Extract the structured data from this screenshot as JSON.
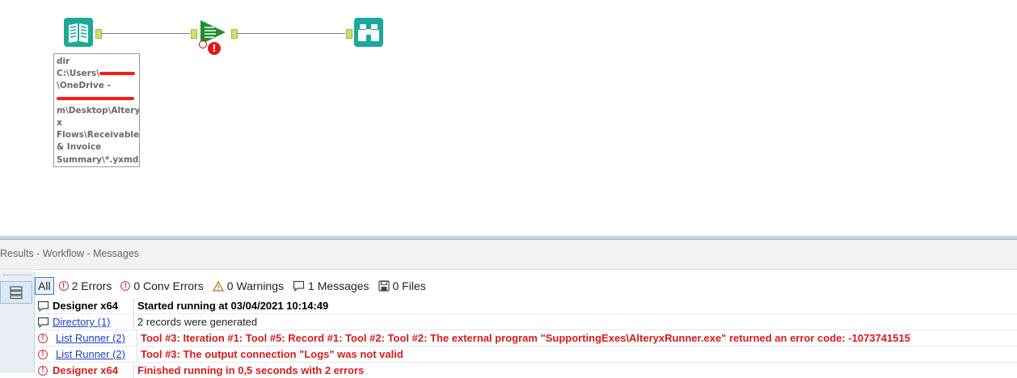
{
  "canvas": {
    "annotation": {
      "line1": "dir",
      "line2_prefix": "C:\\Users\\",
      "line3": "\\OneDrive -",
      "line5": "m\\Desktop\\Altery",
      "line6": "x",
      "line7": "Flows\\Receivable",
      "line8": "& Invoice",
      "line9": "Summary\\*.yxmd"
    },
    "tools": [
      {
        "name": "directory-tool",
        "icon": "book-icon"
      },
      {
        "name": "list-runner-tool",
        "icon": "play-list-icon",
        "error_mark": "!"
      },
      {
        "name": "browse-tool",
        "icon": "binoculars-icon"
      }
    ],
    "colors": {
      "teal": "#1aa99a",
      "green": "#1f8f2e",
      "error_red": "#e01818"
    }
  },
  "results": {
    "title": "Results - Workflow - Messages",
    "filters": {
      "all": "All",
      "errors": "2 Errors",
      "conv_errors": "0 Conv Errors",
      "warnings": "0 Warnings",
      "messages": "1 Messages",
      "files": "0 Files"
    },
    "rows": [
      {
        "icon": "message-icon",
        "tool": "Designer x64",
        "message": "Started running at 03/04/2021 10:14:49"
      },
      {
        "icon": "message-icon",
        "tool": "Directory (1)",
        "message": "2 records were generated"
      },
      {
        "icon": "error-icon",
        "tool": "List Runner (2)",
        "message": "Tool #3: Iteration #1: Tool #5: Record #1: Tool #2: Tool #2: The external program \"SupportingExes\\AlteryxRunner.exe\" returned an error code: -1073741515"
      },
      {
        "icon": "error-icon",
        "tool": "List Runner (2)",
        "message": "Tool #3: The output connection \"Logs\" was not valid"
      },
      {
        "icon": "error-icon",
        "tool": "Designer x64",
        "message": "Finished running in 0,5 seconds with 2 errors"
      }
    ]
  }
}
